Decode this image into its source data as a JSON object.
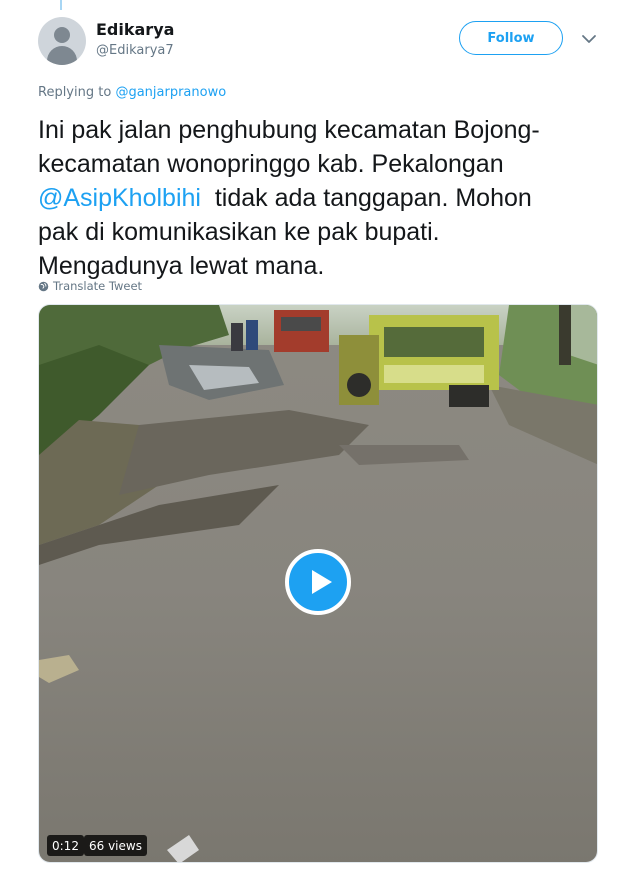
{
  "author": {
    "name": "Edikarya",
    "handle": "@Edikarya7"
  },
  "follow_label": "Follow",
  "reply": {
    "prefix": "Replying to",
    "mention": "@ganjarpranowo"
  },
  "tweet": {
    "line1": "Ini pak jalan penghubung kecamatan Bojong-",
    "line2": "kecamatan wonopringgo kab. Pekalongan",
    "mention": "@AsipKholbihi",
    "line3_rest": "  tidak ada tanggapan. Mohon",
    "line4": "pak di komunikasikan ke pak bupati.",
    "line5": "Mengadunya lewat mana."
  },
  "translate_label": "Translate Tweet",
  "video": {
    "duration": "0:12",
    "views": "66 views"
  },
  "colors": {
    "accent": "#1da1f2",
    "secondary_text": "#657786"
  },
  "icons": [
    "avatar-default-icon",
    "chevron-down-icon",
    "globe-icon",
    "play-icon"
  ]
}
